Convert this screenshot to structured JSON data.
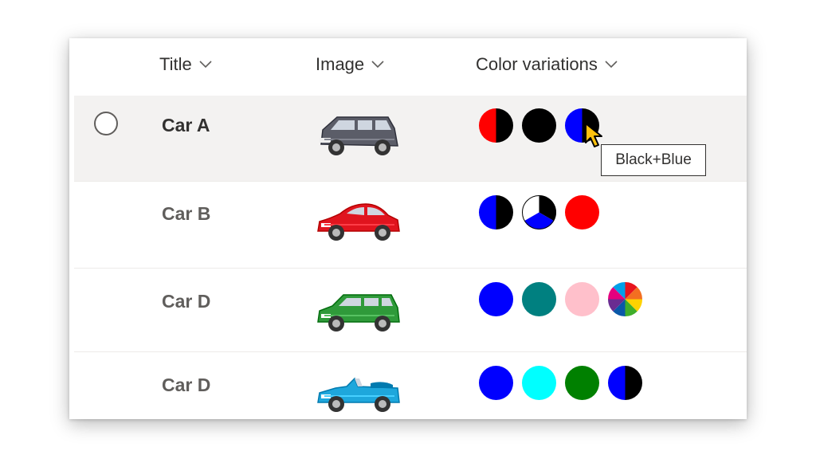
{
  "list": {
    "columns": [
      {
        "label": "Title"
      },
      {
        "label": "Image"
      },
      {
        "label": "Color variations"
      }
    ],
    "rows": [
      {
        "title": "Car A",
        "car_color": "#5b5d68",
        "car_type": "suv",
        "colors": [
          "red+black",
          "black",
          "blue+black"
        ],
        "selected": true
      },
      {
        "title": "Car B",
        "car_color": "#e0141e",
        "car_type": "coupe",
        "colors": [
          "blue+black",
          "black+white+blue",
          "red"
        ],
        "selected": false
      },
      {
        "title": "Car D",
        "car_color": "#2f9a3a",
        "car_type": "wagon",
        "colors": [
          "blue",
          "teal",
          "pink",
          "rainbow"
        ],
        "selected": false
      },
      {
        "title": "Car D",
        "car_color": "#1ea7dc",
        "car_type": "convertible",
        "colors": [
          "blue",
          "cyan",
          "green",
          "blue+black"
        ],
        "selected": false
      }
    ]
  },
  "tooltip": {
    "text": "Black+Blue"
  },
  "icons": {
    "column_sort": "chevron-down-icon",
    "row_select": "radio-circle-icon",
    "pointer": "arrow-cursor-icon"
  },
  "colors": {
    "red": "#ff0000",
    "black": "#000000",
    "blue": "#0000ff",
    "teal": "#008080",
    "pink": "#ffc0cb",
    "cyan": "#00ffff",
    "green": "#008000",
    "white": "#ffffff",
    "selected_row_bg": "#f3f2f1",
    "text": "#323130"
  }
}
